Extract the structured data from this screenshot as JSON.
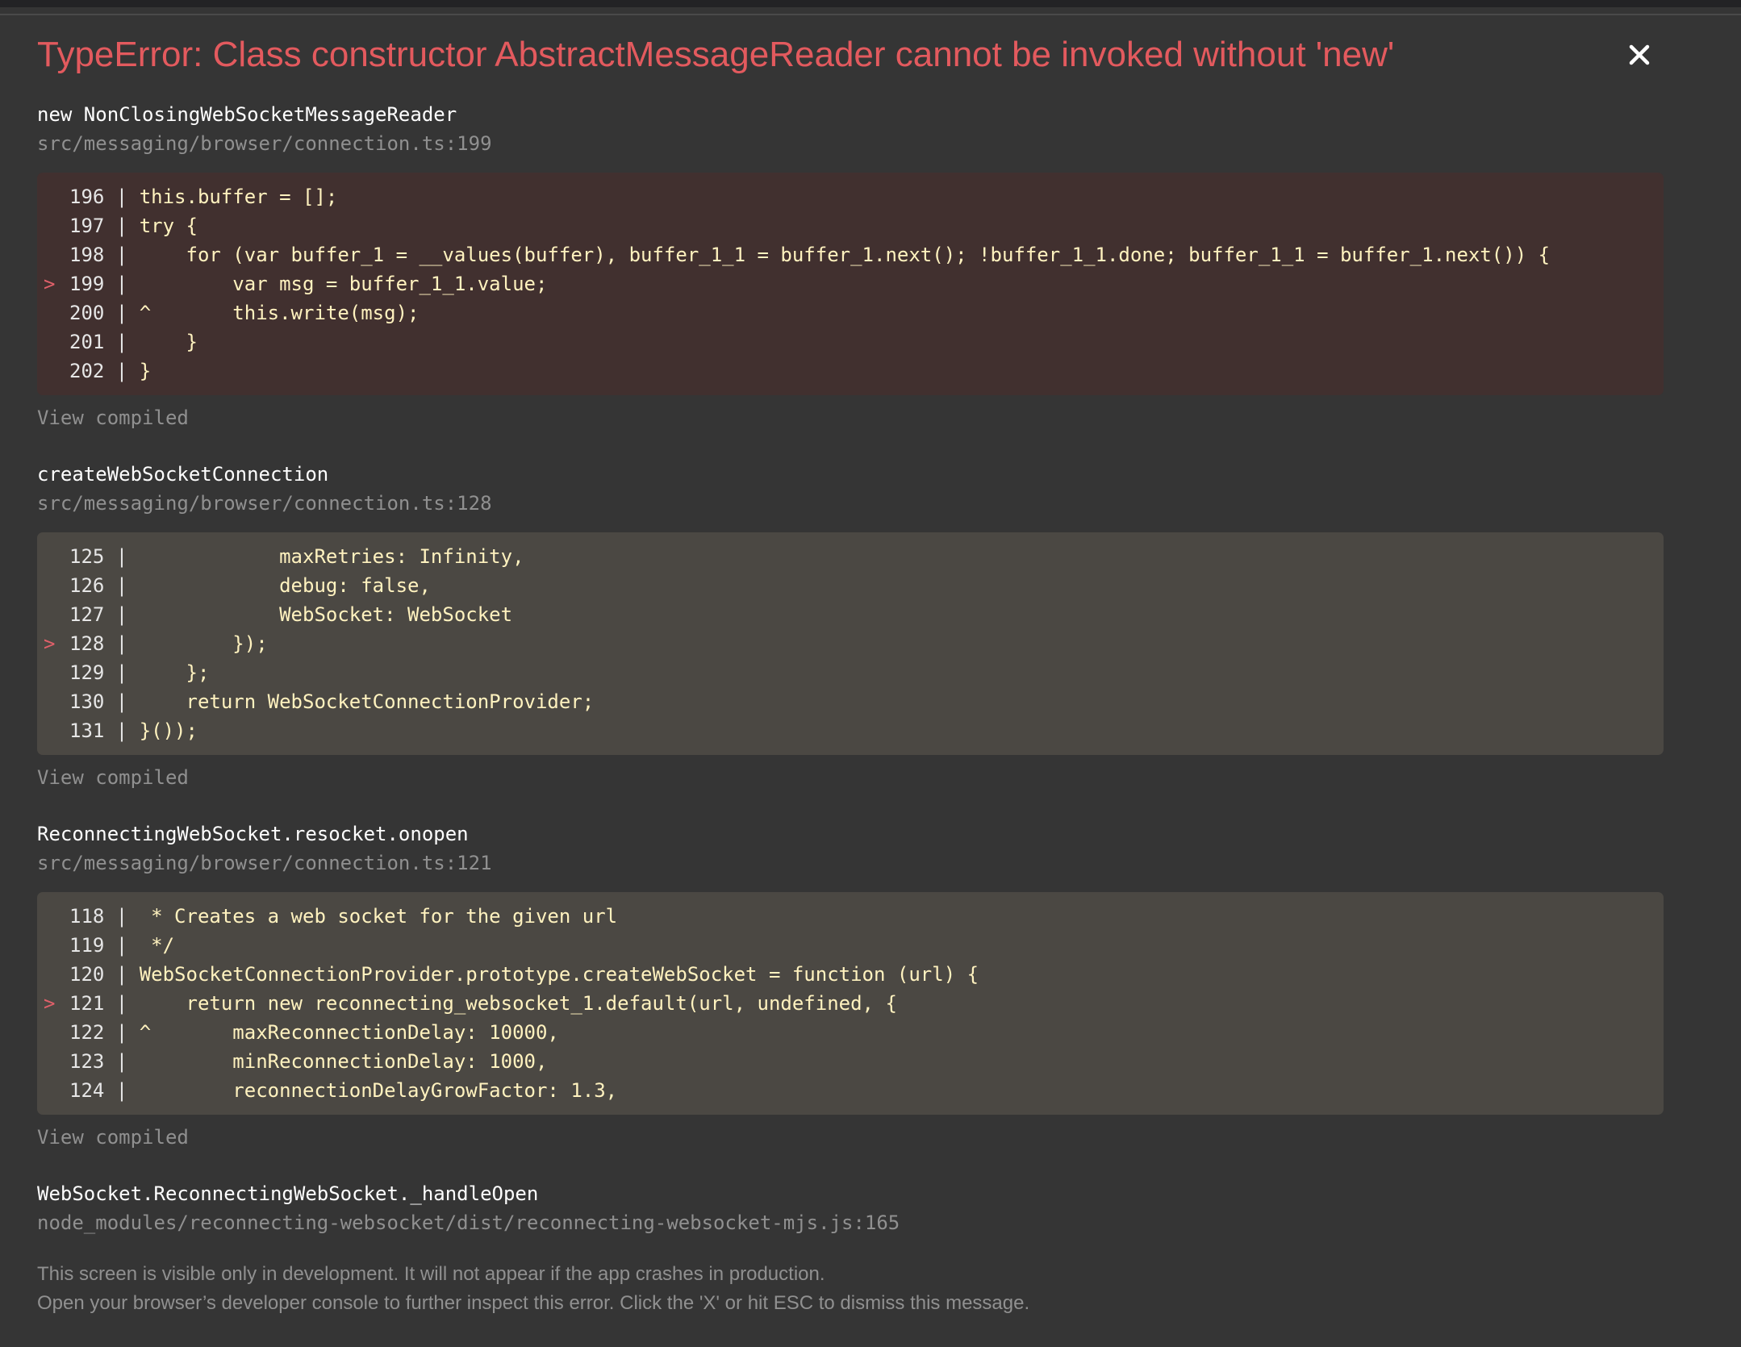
{
  "error": {
    "title": "TypeError: Class constructor AbstractMessageReader cannot be invoked without 'new'"
  },
  "close_icon": "close-icon",
  "frames": [
    {
      "function": "new NonClosingWebSocketMessageReader",
      "file": "src/messaging/browser/connection.ts:199",
      "highlight": true,
      "view_compiled": "View compiled",
      "lines": [
        {
          "marker": " ",
          "gutter": "196 |",
          "code": " this.buffer = [];"
        },
        {
          "marker": " ",
          "gutter": "197 |",
          "code": " try {"
        },
        {
          "marker": " ",
          "gutter": "198 |",
          "code": "     for (var buffer_1 = __values(buffer), buffer_1_1 = buffer_1.next(); !buffer_1_1.done; buffer_1_1 = buffer_1.next()) {"
        },
        {
          "marker": ">",
          "gutter": "199 |",
          "code": "         var msg = buffer_1_1.value;"
        },
        {
          "marker": " ",
          "gutter": "200 |",
          "code": " ^       this.write(msg);"
        },
        {
          "marker": " ",
          "gutter": "201 |",
          "code": "     }"
        },
        {
          "marker": " ",
          "gutter": "202 |",
          "code": " }"
        }
      ]
    },
    {
      "function": "createWebSocketConnection",
      "file": "src/messaging/browser/connection.ts:128",
      "highlight": false,
      "view_compiled": "View compiled",
      "lines": [
        {
          "marker": " ",
          "gutter": "125 |",
          "code": "             maxRetries: Infinity,"
        },
        {
          "marker": " ",
          "gutter": "126 |",
          "code": "             debug: false,"
        },
        {
          "marker": " ",
          "gutter": "127 |",
          "code": "             WebSocket: WebSocket"
        },
        {
          "marker": ">",
          "gutter": "128 |",
          "code": "         });"
        },
        {
          "marker": " ",
          "gutter": "129 |",
          "code": "     };"
        },
        {
          "marker": " ",
          "gutter": "130 |",
          "code": "     return WebSocketConnectionProvider;"
        },
        {
          "marker": " ",
          "gutter": "131 |",
          "code": " }());"
        }
      ]
    },
    {
      "function": "ReconnectingWebSocket.resocket.onopen",
      "file": "src/messaging/browser/connection.ts:121",
      "highlight": false,
      "view_compiled": "View compiled",
      "lines": [
        {
          "marker": " ",
          "gutter": "118 |",
          "code": "  * Creates a web socket for the given url"
        },
        {
          "marker": " ",
          "gutter": "119 |",
          "code": "  */"
        },
        {
          "marker": " ",
          "gutter": "120 |",
          "code": " WebSocketConnectionProvider.prototype.createWebSocket = function (url) {"
        },
        {
          "marker": ">",
          "gutter": "121 |",
          "code": "     return new reconnecting_websocket_1.default(url, undefined, {"
        },
        {
          "marker": " ",
          "gutter": "122 |",
          "code": " ^       maxReconnectionDelay: 10000,"
        },
        {
          "marker": " ",
          "gutter": "123 |",
          "code": "         minReconnectionDelay: 1000,"
        },
        {
          "marker": " ",
          "gutter": "124 |",
          "code": "         reconnectionDelayGrowFactor: 1.3,"
        }
      ]
    },
    {
      "function": "WebSocket.ReconnectingWebSocket._handleOpen",
      "file": "node_modules/reconnecting-websocket/dist/reconnecting-websocket-mjs.js:165"
    }
  ],
  "footer": {
    "line1": "This screen is visible only in development. It will not appear if the app crashes in production.",
    "line2": "Open your browser’s developer console to further inspect this error.  Click the 'X' or hit ESC to dismiss this message."
  },
  "colors": {
    "background": "#353535",
    "error_red": "#e35a5e",
    "highlight_block": "#41302f",
    "code_block": "#4b4843",
    "muted_text": "#909090"
  }
}
